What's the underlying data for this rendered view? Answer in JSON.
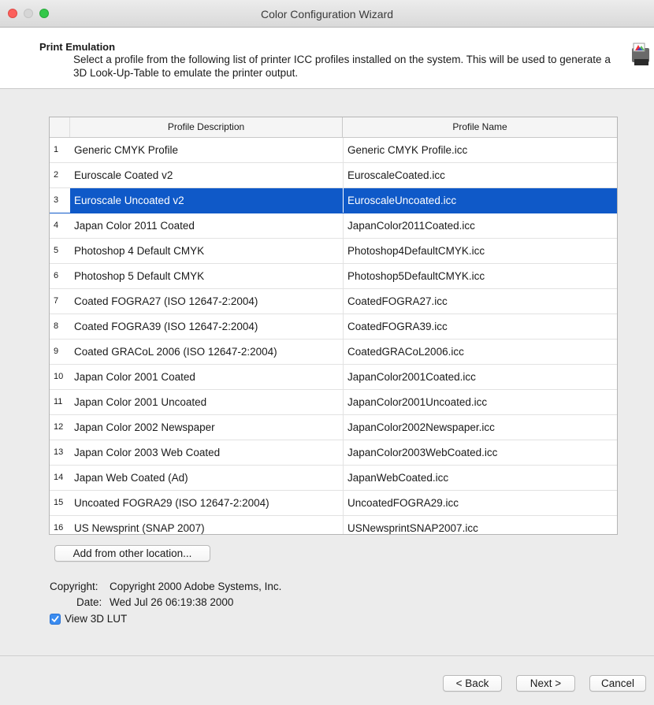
{
  "window": {
    "title": "Color Configuration Wizard"
  },
  "header": {
    "title": "Print Emulation",
    "description": "Select a profile from the following list of printer ICC profiles installed on the system. This will be used to generate a 3D Look-Up-Table to emulate the printer output.",
    "icon": "printer-profile-icon"
  },
  "table": {
    "columns": [
      "Profile Description",
      "Profile Name"
    ],
    "selected_index": 3,
    "rows": [
      {
        "num": "1",
        "description": "Generic CMYK Profile",
        "name": "Generic CMYK Profile.icc"
      },
      {
        "num": "2",
        "description": "Euroscale Coated v2",
        "name": "EuroscaleCoated.icc"
      },
      {
        "num": "3",
        "description": "Euroscale Uncoated v2",
        "name": "EuroscaleUncoated.icc"
      },
      {
        "num": "4",
        "description": "Japan Color 2011 Coated",
        "name": "JapanColor2011Coated.icc"
      },
      {
        "num": "5",
        "description": "Photoshop 4 Default CMYK",
        "name": "Photoshop4DefaultCMYK.icc"
      },
      {
        "num": "6",
        "description": "Photoshop 5 Default CMYK",
        "name": "Photoshop5DefaultCMYK.icc"
      },
      {
        "num": "7",
        "description": "Coated FOGRA27 (ISO 12647-2:2004)",
        "name": "CoatedFOGRA27.icc"
      },
      {
        "num": "8",
        "description": "Coated FOGRA39 (ISO 12647-2:2004)",
        "name": "CoatedFOGRA39.icc"
      },
      {
        "num": "9",
        "description": "Coated GRACoL 2006 (ISO 12647-2:2004)",
        "name": "CoatedGRACoL2006.icc"
      },
      {
        "num": "10",
        "description": "Japan Color 2001 Coated",
        "name": "JapanColor2001Coated.icc"
      },
      {
        "num": "11",
        "description": "Japan Color 2001 Uncoated",
        "name": "JapanColor2001Uncoated.icc"
      },
      {
        "num": "12",
        "description": "Japan Color 2002 Newspaper",
        "name": "JapanColor2002Newspaper.icc"
      },
      {
        "num": "13",
        "description": "Japan Color 2003 Web Coated",
        "name": "JapanColor2003WebCoated.icc"
      },
      {
        "num": "14",
        "description": "Japan Web Coated (Ad)",
        "name": "JapanWebCoated.icc"
      },
      {
        "num": "15",
        "description": "Uncoated FOGRA29 (ISO 12647-2:2004)",
        "name": "UncoatedFOGRA29.icc"
      },
      {
        "num": "16",
        "description": "US Newsprint (SNAP 2007)",
        "name": "USNewsprintSNAP2007.icc"
      }
    ]
  },
  "add_button_label": "Add from other location...",
  "info": {
    "copyright_label": "Copyright:",
    "copyright_value": "Copyright 2000 Adobe Systems, Inc.",
    "date_label": "Date:",
    "date_value": "Wed Jul 26 06:19:38 2000"
  },
  "view_3d_lut": {
    "label": "View 3D LUT",
    "checked": true
  },
  "footer": {
    "back_label": "< Back",
    "next_label": "Next >",
    "cancel_label": "Cancel"
  },
  "colors": {
    "selection": "#0f59c8",
    "checkbox": "#3b8cf0"
  }
}
